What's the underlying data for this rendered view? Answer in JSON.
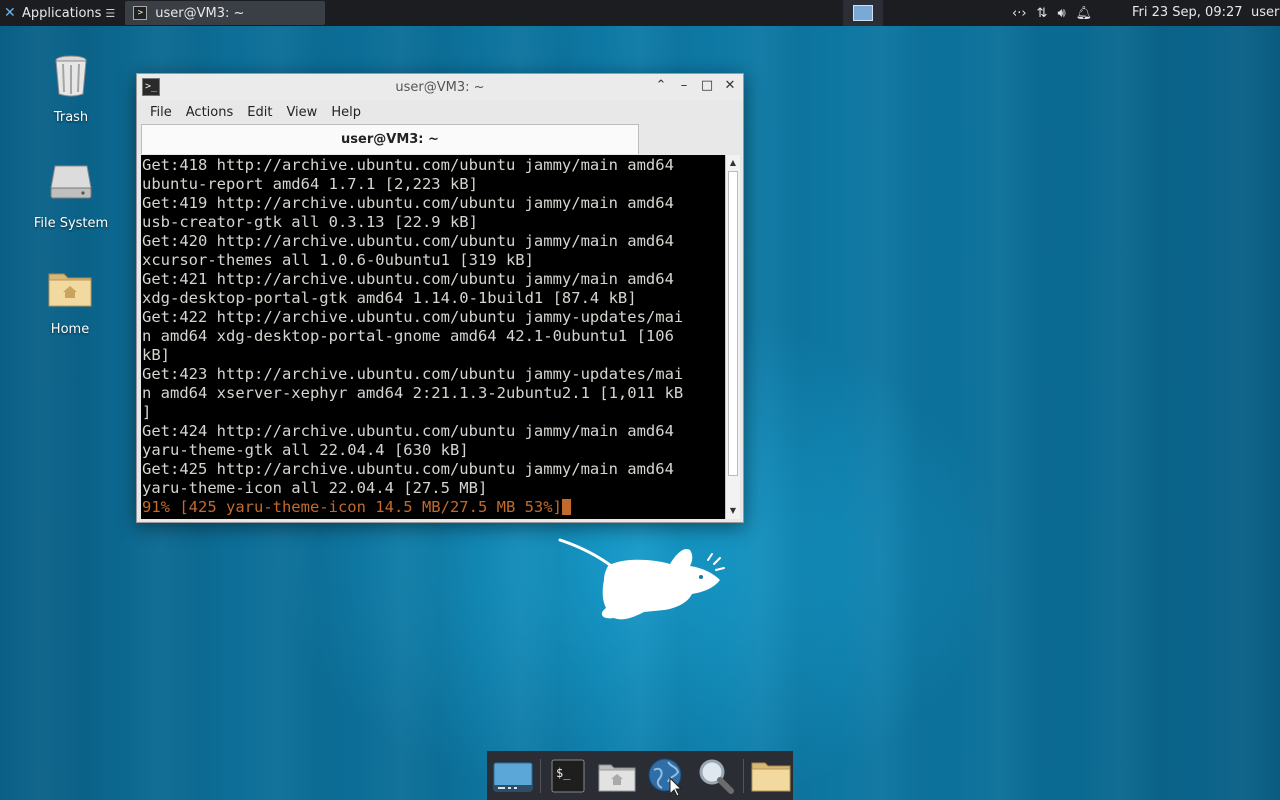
{
  "top_panel": {
    "applications_label": "Applications",
    "task_title": "user@VM3: ~",
    "clock": "Fri 23 Sep, 09:27",
    "user": "user",
    "tray_icons": [
      "network-icon",
      "transfer-icon",
      "volume-icon",
      "notification-bell-icon"
    ]
  },
  "desktop_icons": [
    {
      "label": "Trash",
      "icon": "trash-icon"
    },
    {
      "label": "File System",
      "icon": "drive-icon"
    },
    {
      "label": "Home",
      "icon": "home-folder-icon"
    }
  ],
  "terminal": {
    "title": "user@VM3: ~",
    "menu": [
      "File",
      "Actions",
      "Edit",
      "View",
      "Help"
    ],
    "tab_label": "user@VM3: ~",
    "lines": [
      "Get:418 http://archive.ubuntu.com/ubuntu jammy/main amd64",
      "ubuntu-report amd64 1.7.1 [2,223 kB]",
      "Get:419 http://archive.ubuntu.com/ubuntu jammy/main amd64",
      "usb-creator-gtk all 0.3.13 [22.9 kB]",
      "Get:420 http://archive.ubuntu.com/ubuntu jammy/main amd64",
      "xcursor-themes all 1.0.6-0ubuntu1 [319 kB]",
      "Get:421 http://archive.ubuntu.com/ubuntu jammy/main amd64",
      "xdg-desktop-portal-gtk amd64 1.14.0-1build1 [87.4 kB]",
      "Get:422 http://archive.ubuntu.com/ubuntu jammy-updates/mai",
      "n amd64 xdg-desktop-portal-gnome amd64 42.1-0ubuntu1 [106",
      "kB]",
      "Get:423 http://archive.ubuntu.com/ubuntu jammy-updates/mai",
      "n amd64 xserver-xephyr amd64 2:21.1.3-2ubuntu2.1 [1,011 kB",
      "]",
      "Get:424 http://archive.ubuntu.com/ubuntu jammy/main amd64",
      "yaru-theme-gtk all 22.04.4 [630 kB]",
      "Get:425 http://archive.ubuntu.com/ubuntu jammy/main amd64",
      "yaru-theme-icon all 22.04.4 [27.5 MB]"
    ],
    "progress_line": "91% [425 yaru-theme-icon 14.5 MB/27.5 MB 53%]"
  },
  "dock": {
    "items": [
      "show-desktop-icon",
      "terminal-icon",
      "home-folder-icon",
      "web-browser-icon",
      "app-finder-icon",
      "files-folder-icon"
    ]
  },
  "colors": {
    "panel": "#1b1d21",
    "terminal_bg": "#000000",
    "terminal_fg": "#d3d7cf",
    "progress": "#c26a2b"
  }
}
